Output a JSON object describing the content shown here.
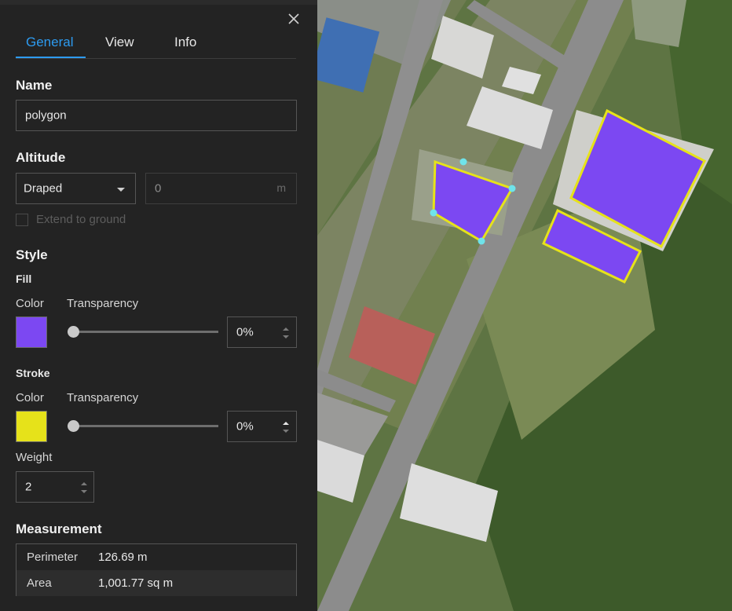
{
  "tabs": [
    {
      "label": "General",
      "active": true
    },
    {
      "label": "View",
      "active": false
    },
    {
      "label": "Info",
      "active": false
    }
  ],
  "name": {
    "heading": "Name",
    "value": "polygon"
  },
  "altitude": {
    "heading": "Altitude",
    "mode": "Draped",
    "value": "0",
    "unit": "m",
    "extend_label": "Extend to ground",
    "extend_checked": false
  },
  "style": {
    "heading": "Style",
    "fill": {
      "heading": "Fill",
      "color_label": "Color",
      "transparency_label": "Transparency",
      "color": "#7c48f2",
      "transparency": "0%",
      "transparency_value": 0
    },
    "stroke": {
      "heading": "Stroke",
      "color_label": "Color",
      "transparency_label": "Transparency",
      "color": "#e6e21a",
      "transparency": "0%",
      "transparency_value": 0,
      "weight_label": "Weight",
      "weight": "2"
    }
  },
  "measurement": {
    "heading": "Measurement",
    "rows": [
      {
        "label": "Perimeter",
        "value": "126.69 m"
      },
      {
        "label": "Area",
        "value": "1,001.77 sq m"
      }
    ]
  },
  "colors": {
    "accent": "#2d9bf0",
    "panel_bg": "#232323",
    "polygon_fill": "#7c48f2",
    "polygon_stroke": "#e6e21a",
    "vertex_handle": "#6fe3ea"
  }
}
